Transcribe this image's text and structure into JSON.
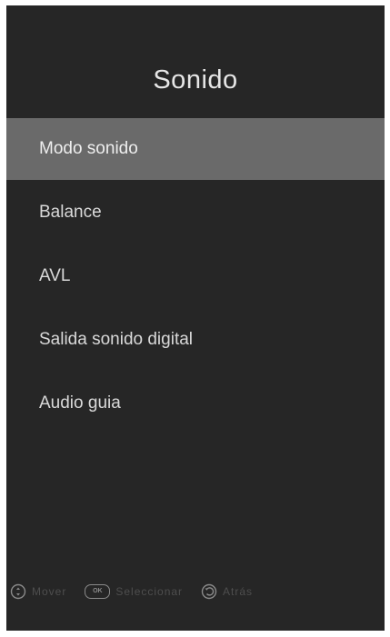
{
  "menu": {
    "title": "Sonido",
    "items": [
      {
        "label": "Modo sonido",
        "selected": true
      },
      {
        "label": "Balance",
        "selected": false
      },
      {
        "label": "AVL",
        "selected": false
      },
      {
        "label": "Salida sonido digital",
        "selected": false
      },
      {
        "label": "Audio guia",
        "selected": false
      }
    ]
  },
  "footer": {
    "hints": [
      {
        "icon": "navigate-updown-icon",
        "label": "Mover"
      },
      {
        "icon": "ok-button-icon",
        "ok_text": "OK",
        "label": "Seleccionar"
      },
      {
        "icon": "back-icon",
        "label": "Atrás"
      }
    ]
  },
  "colors": {
    "background": "#262626",
    "selected": "#6a6a6a",
    "text": "#d9d9d9"
  }
}
